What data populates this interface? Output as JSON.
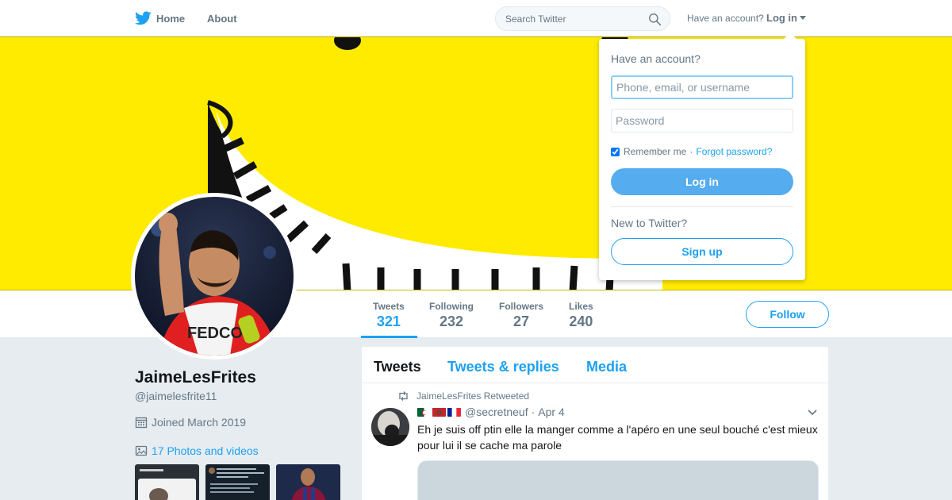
{
  "nav": {
    "home_label": "Home",
    "about_label": "About",
    "search_placeholder": "Search Twitter",
    "have_account": "Have an account?",
    "login_label": "Log in",
    "brand_color": "#1da1f2"
  },
  "profile": {
    "name": "JaimeLesFrites",
    "handle": "@jaimelesfrite11",
    "joined": "Joined March 2019",
    "photos_link": "17 Photos and videos",
    "banner_color": "#ffeb00",
    "follow_label": "Follow",
    "stats": [
      {
        "label": "Tweets",
        "value": "321",
        "active": true
      },
      {
        "label": "Following",
        "value": "232"
      },
      {
        "label": "Followers",
        "value": "27"
      },
      {
        "label": "Likes",
        "value": "240"
      }
    ]
  },
  "timeline": {
    "tabs": [
      {
        "label": "Tweets",
        "active": true
      },
      {
        "label": "Tweets & replies"
      },
      {
        "label": "Media"
      }
    ],
    "tweet": {
      "retweet_note": "JaimeLesFrites Retweeted",
      "handle": "@secretneuf",
      "separator": "·",
      "date": "Apr 4",
      "text": "Eh je suis off ptin elle la manger comme a l'apéro en une seul bouché c'est mieux pour lui il se cache ma parole",
      "flags": [
        "algeria-flag",
        "morocco-flag",
        "france-flag"
      ]
    }
  },
  "login_dropdown": {
    "title": "Have an account?",
    "username_placeholder": "Phone, email, or username",
    "password_placeholder": "Password",
    "remember_label": "Remember me",
    "separator": "·",
    "forgot_label": "Forgot password?",
    "login_button": "Log in",
    "new_label": "New to Twitter?",
    "signup_button": "Sign up"
  },
  "icons": [
    "twitter-bird-icon",
    "search-icon",
    "calendar-icon",
    "photo-icon",
    "retweet-icon",
    "chevron-down-icon"
  ]
}
